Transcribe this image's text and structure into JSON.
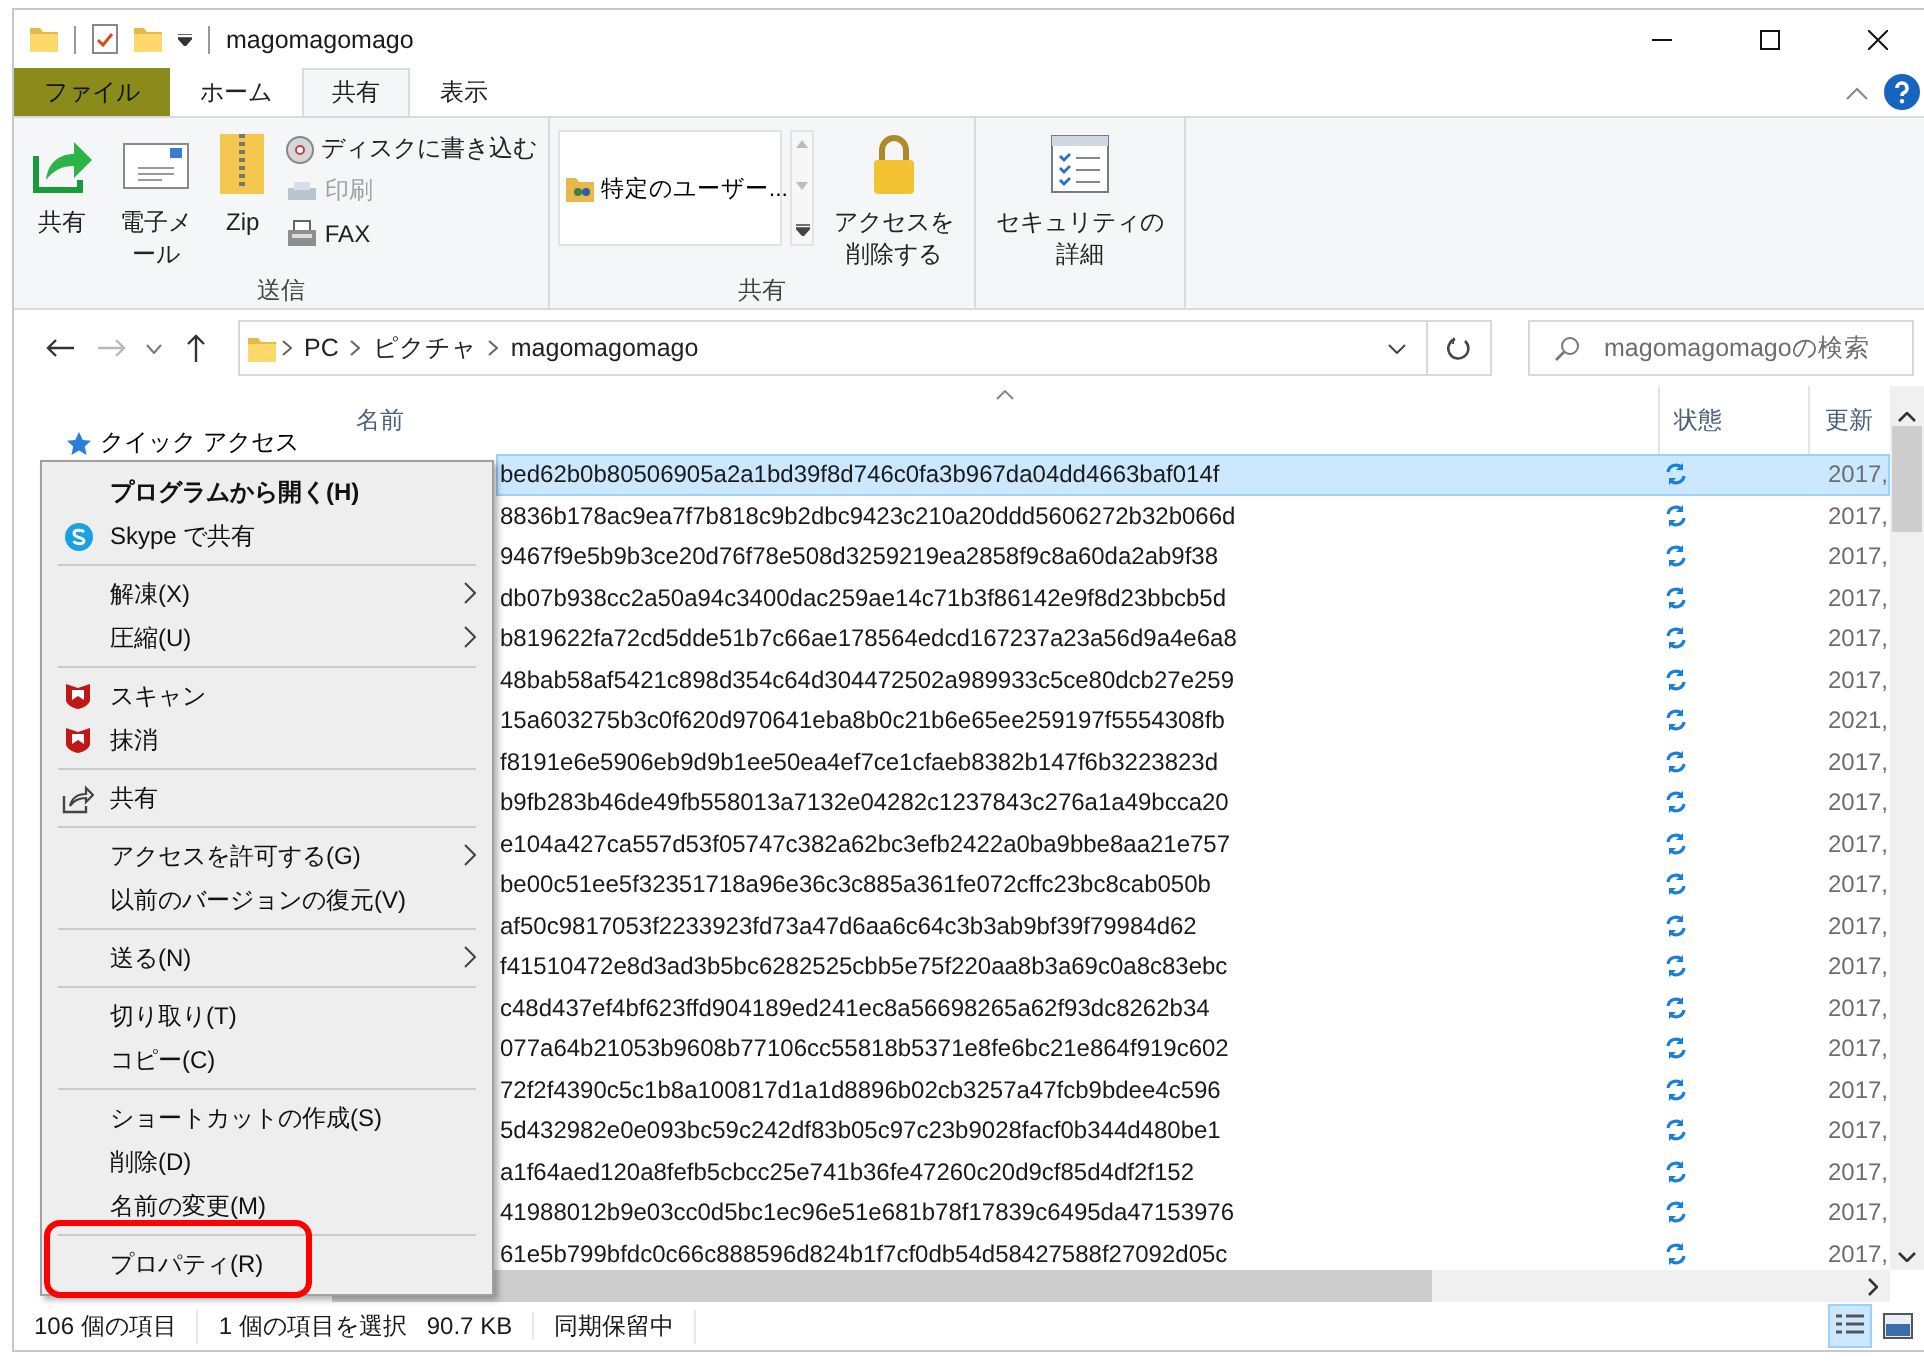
{
  "window": {
    "title": "magomagomago"
  },
  "ribbon": {
    "tabs": [
      {
        "label": "ファイル",
        "kind": "file",
        "selected": false
      },
      {
        "label": "ホーム",
        "kind": "tab",
        "selected": false
      },
      {
        "label": "共有",
        "kind": "tab",
        "selected": true
      },
      {
        "label": "表示",
        "kind": "tab",
        "selected": false
      }
    ],
    "groups": [
      {
        "label": "送信",
        "buttons": [
          {
            "label": "共有"
          },
          {
            "label": "電子メール"
          },
          {
            "label": "Zip"
          }
        ],
        "small": [
          {
            "label": "ディスクに書き込む",
            "disabled": false
          },
          {
            "label": "印刷",
            "disabled": true
          },
          {
            "label": "FAX",
            "disabled": false
          }
        ]
      },
      {
        "label": "共有",
        "share_list": [
          {
            "label": "特定のユーザー..."
          }
        ],
        "buttons": [
          {
            "label": "アクセスを削除する"
          }
        ]
      },
      {
        "buttons": [
          {
            "label": "セキュリティの詳細"
          }
        ]
      }
    ]
  },
  "address": {
    "crumbs": [
      "PC",
      "ピクチャ",
      "magomagomago"
    ]
  },
  "search": {
    "placeholder": "magomagomagoの検索"
  },
  "navigation": {
    "items": [
      {
        "label": "クイック アクセス"
      }
    ]
  },
  "file_list": {
    "columns": [
      "名前",
      "状態",
      "更新"
    ],
    "rows": [
      {
        "name": "bed62b0b80506905a2a1bd39f8d746c0fa3b967da04dd4663baf014f",
        "date": "2017,",
        "selected": true
      },
      {
        "name": "8836b178ac9ea7f7b818c9b2dbc9423c210a20ddd5606272b32b066d",
        "date": "2017,",
        "selected": false
      },
      {
        "name": "9467f9e5b9b3ce20d76f78e508d3259219ea2858f9c8a60da2ab9f38",
        "date": "2017,",
        "selected": false
      },
      {
        "name": "db07b938cc2a50a94c3400dac259ae14c71b3f86142e9f8d23bbcb5d",
        "date": "2017,",
        "selected": false
      },
      {
        "name": "b819622fa72cd5dde51b7c66ae178564edcd167237a23a56d9a4e6a8",
        "date": "2017,",
        "selected": false
      },
      {
        "name": "48bab58af5421c898d354c64d304472502a989933c5ce80dcb27e259",
        "date": "2017,",
        "selected": false
      },
      {
        "name": "15a603275b3c0f620d970641eba8b0c21b6e65ee259197f5554308fb",
        "date": "2021,",
        "selected": false
      },
      {
        "name": "f8191e6e5906eb9d9b1ee50ea4ef7ce1cfaeb8382b147f6b3223823d",
        "date": "2017,",
        "selected": false
      },
      {
        "name": "b9fb283b46de49fb558013a7132e04282c1237843c276a1a49bcca20",
        "date": "2017,",
        "selected": false
      },
      {
        "name": "e104a427ca557d53f05747c382a62bc3efb2422a0ba9bbe8aa21e757",
        "date": "2017,",
        "selected": false
      },
      {
        "name": "be00c51ee5f32351718a96e36c3c885a361fe072cffc23bc8cab050b",
        "date": "2017,",
        "selected": false
      },
      {
        "name": "af50c9817053f2233923fd73a47d6aa6c64c3b3ab9bf39f79984d62",
        "date": "2017,",
        "selected": false
      },
      {
        "name": "f41510472e8d3ad3b5bc6282525cbb5e75f220aa8b3a69c0a8c83ebc",
        "date": "2017,",
        "selected": false
      },
      {
        "name": "c48d437ef4bf623ffd904189ed241ec8a56698265a62f93dc8262b34",
        "date": "2017,",
        "selected": false
      },
      {
        "name": "077a64b21053b9608b77106cc55818b5371e8fe6bc21e864f919c602",
        "date": "2017,",
        "selected": false
      },
      {
        "name": "72f2f4390c5c1b8a100817d1a1d8896b02cb3257a47fcb9bdee4c596",
        "date": "2017,",
        "selected": false
      },
      {
        "name": "5d432982e0e093bc59c242df83b05c97c23b9028facf0b344d480be1",
        "date": "2017,",
        "selected": false
      },
      {
        "name": "a1f64aed120a8fefb5cbcc25e741b36fe47260c20d9cf85d4df2f152",
        "date": "2017,",
        "selected": false
      },
      {
        "name": "41988012b9e03cc0d5bc1ec96e51e681b78f17839c6495da47153976",
        "date": "2017,",
        "selected": false
      },
      {
        "name": "61e5b799bfdc0c66c888596d824b1f7cf0db54d58427588f27092d05c",
        "date": "2017,",
        "selected": false
      }
    ]
  },
  "status_bar": {
    "items": [
      "106 個の項目",
      "1 個の項目を選択",
      "90.7 KB",
      "同期保留中"
    ],
    "views": [
      {
        "kind": "details",
        "selected": true
      },
      {
        "kind": "large-icons",
        "selected": false
      }
    ]
  },
  "context_menu": {
    "sections": [
      [
        {
          "label": "プログラムから開く(H)",
          "default": true,
          "submenu": false,
          "annotated": false
        },
        {
          "label": "Skype で共有",
          "default": false,
          "submenu": false,
          "annotated": false
        }
      ],
      [
        {
          "label": "解凍(X)",
          "default": false,
          "submenu": true,
          "annotated": false
        },
        {
          "label": "圧縮(U)",
          "default": false,
          "submenu": true,
          "annotated": false
        }
      ],
      [
        {
          "label": "スキャン",
          "default": false,
          "submenu": false,
          "annotated": false
        },
        {
          "label": "抹消",
          "default": false,
          "submenu": false,
          "annotated": false
        }
      ],
      [
        {
          "label": "共有",
          "default": false,
          "submenu": false,
          "annotated": false
        }
      ],
      [
        {
          "label": "アクセスを許可する(G)",
          "default": false,
          "submenu": true,
          "annotated": false
        },
        {
          "label": "以前のバージョンの復元(V)",
          "default": false,
          "submenu": false,
          "annotated": false
        }
      ],
      [
        {
          "label": "送る(N)",
          "default": false,
          "submenu": true,
          "annotated": false
        }
      ],
      [
        {
          "label": "切り取り(T)",
          "default": false,
          "submenu": false,
          "annotated": false
        },
        {
          "label": "コピー(C)",
          "default": false,
          "submenu": false,
          "annotated": false
        }
      ],
      [
        {
          "label": "ショートカットの作成(S)",
          "default": false,
          "submenu": false,
          "annotated": false
        },
        {
          "label": "削除(D)",
          "default": false,
          "submenu": false,
          "annotated": false
        },
        {
          "label": "名前の変更(M)",
          "default": false,
          "submenu": false,
          "annotated": false
        }
      ],
      [
        {
          "label": "プロパティ(R)",
          "default": false,
          "submenu": false,
          "annotated": true
        }
      ]
    ]
  }
}
